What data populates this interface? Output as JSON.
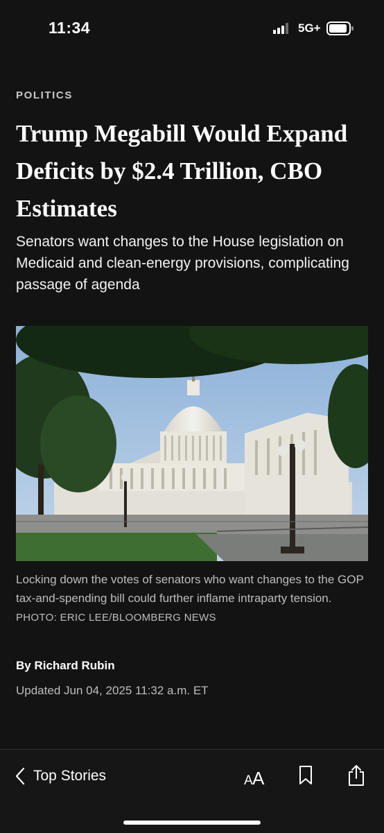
{
  "status_bar": {
    "time": "11:34",
    "network": "5G+",
    "icons": [
      "signal-bars-icon",
      "battery-icon"
    ]
  },
  "article": {
    "section": "POLITICS",
    "headline": "Trump Megabill Would Expand Deficits by $2.4 Trillion, CBO Estimates",
    "dek": "Senators want changes to the House legislation on Medicaid and clean-energy provisions, complicating passage of agenda",
    "image_caption": "Locking down the votes of senators who want changes to the GOP tax-and-spending bill could further inflame intraparty tension.",
    "image_credit": "PHOTO: ERIC LEE/BLOOMBERG NEWS",
    "byline": "By Richard Rubin",
    "updated": "Updated Jun 04, 2025 11:32 a.m. ET"
  },
  "bottom_bar": {
    "back_label": "Top Stories",
    "icons": [
      "chevron-left-icon",
      "text-size-icon",
      "bookmark-icon",
      "share-icon"
    ]
  },
  "colors": {
    "background": "#131313",
    "text": "#ffffff",
    "secondary_text": "#bdbdbd"
  }
}
